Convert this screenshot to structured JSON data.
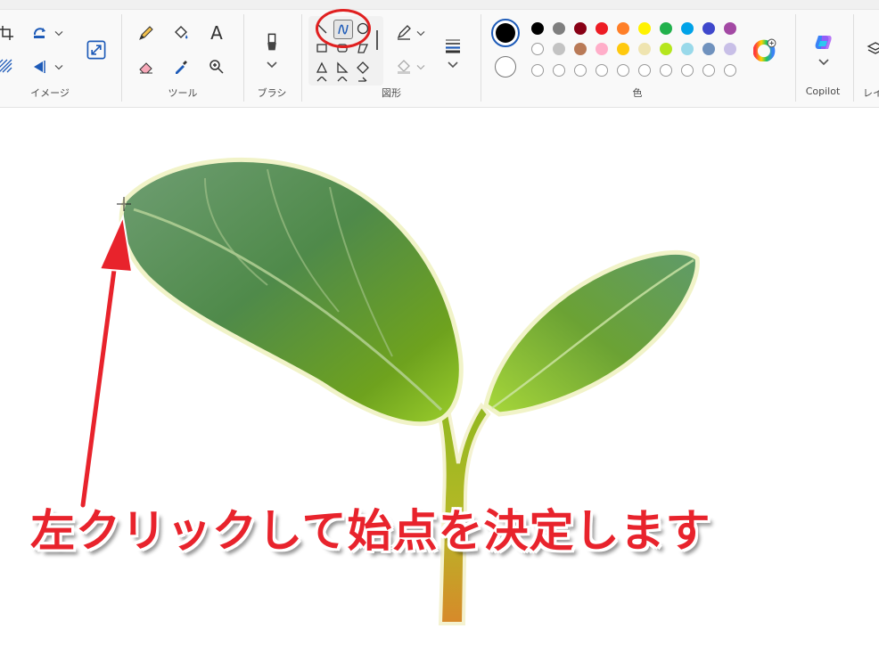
{
  "groups": {
    "image": {
      "label": "イメージ"
    },
    "tools": {
      "label": "ツール"
    },
    "brush": {
      "label": "ブラシ"
    },
    "shapes": {
      "label": "図形"
    },
    "colors": {
      "label": "色"
    },
    "copilot": {
      "label": "Copilot"
    },
    "layers": {
      "label": "レイ"
    }
  },
  "tools": {
    "text_glyph": "A"
  },
  "colors": {
    "primary": "#000000",
    "secondary": "#ffffff",
    "row1": [
      "#000000",
      "#7f7f7f",
      "#880015",
      "#ed1c24",
      "#ff7f27",
      "#fff200",
      "#22b14c",
      "#00a2e8",
      "#3f48cc",
      "#a349a4"
    ],
    "row2": [
      "#ffffff",
      "#c3c3c3",
      "#b97a57",
      "#ffaec9",
      "#ffc90e",
      "#efe4b0",
      "#b5e61d",
      "#99d9ea",
      "#7092be",
      "#c8bfe7"
    ],
    "row3_count": 10,
    "highlight": "#e02020"
  },
  "annotation": {
    "caption": "左クリックして始点を決定します",
    "color": "#e8232c"
  }
}
